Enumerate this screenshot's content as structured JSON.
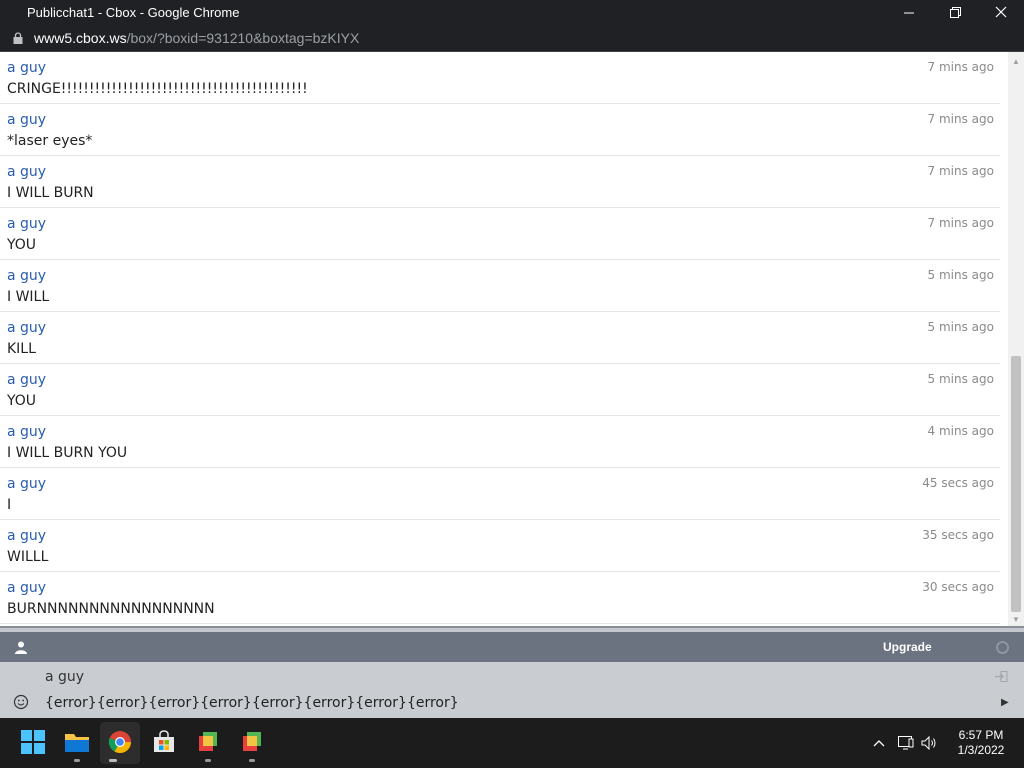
{
  "window": {
    "title": "Publicchat1 - Cbox - Google Chrome",
    "url_host": "www5.cbox.ws",
    "url_path": "/box/?boxid=931210&boxtag=bzKIYX"
  },
  "messages": [
    {
      "user": "a guy",
      "text": "CRINGE!!!!!!!!!!!!!!!!!!!!!!!!!!!!!!!!!!!!!!!!!!!!",
      "time": "7 mins ago"
    },
    {
      "user": "a guy",
      "text": "*laser eyes*",
      "time": "7 mins ago"
    },
    {
      "user": "a guy",
      "text": "I WILL BURN",
      "time": "7 mins ago"
    },
    {
      "user": "a guy",
      "text": "YOU",
      "time": "7 mins ago"
    },
    {
      "user": "a guy",
      "text": "I WILL",
      "time": "5 mins ago"
    },
    {
      "user": "a guy",
      "text": "KILL",
      "time": "5 mins ago"
    },
    {
      "user": "a guy",
      "text": "YOU",
      "time": "5 mins ago"
    },
    {
      "user": "a guy",
      "text": "I WILL BURN YOU",
      "time": "4 mins ago"
    },
    {
      "user": "a guy",
      "text": "I",
      "time": "45 secs ago"
    },
    {
      "user": "a guy",
      "text": "WILLL",
      "time": "35 secs ago"
    },
    {
      "user": "a guy",
      "text": "BURNNNNNNNNNNNNNNNNN",
      "time": "30 secs ago"
    }
  ],
  "userbar": {
    "upgrade_label": "Upgrade"
  },
  "composer": {
    "name": "a guy",
    "message_value": "{error}{error}{error}{error}{error}{error}{error}{error}"
  },
  "taskbar": {
    "time": "6:57 PM",
    "date": "1/3/2022"
  },
  "colors": {
    "username": "#2a5db0",
    "userbar_bg": "#6b7380",
    "composer_bg": "#c9cdd2",
    "titlebar_bg": "#202124"
  }
}
